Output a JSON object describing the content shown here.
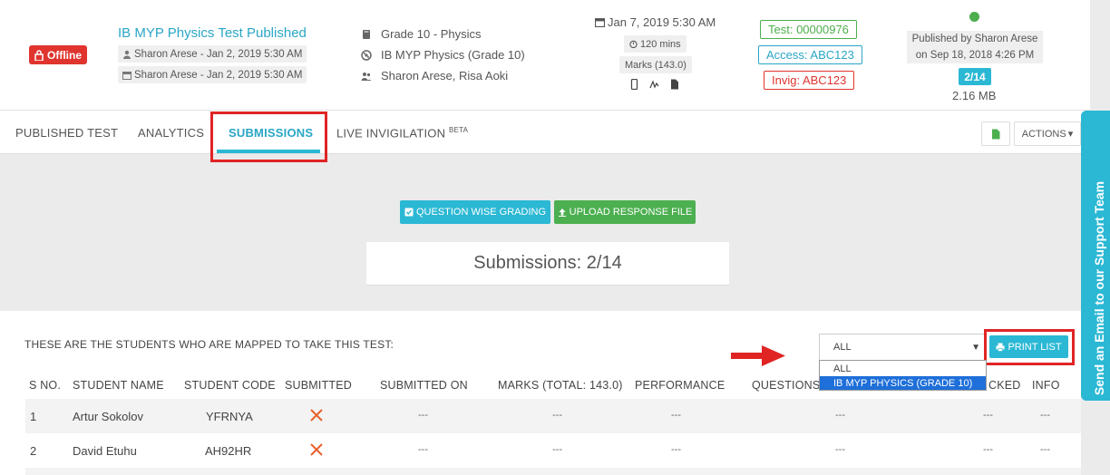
{
  "header": {
    "offline_label": "Offline",
    "test_title": "IB MYP Physics Test Published",
    "created_by": "Sharon Arese - Jan 2, 2019 5:30 AM",
    "modified_by": "Sharon Arese - Jan 2, 2019 5:30 AM",
    "grade": "Grade 10 - Physics",
    "course": "IB MYP Physics (Grade 10)",
    "teachers": "Sharon Arese, Risa Aoki",
    "date": "Jan 7, 2019 5:30 AM",
    "duration": "120 mins",
    "marks": "Marks (143.0)",
    "test_code": "Test: 00000976",
    "access_code": "Access: ABC123",
    "invig_code": "Invig: ABC123",
    "published_line1": "Published by Sharon Arese",
    "published_line2": "on Sep 18, 2018 4:26 PM",
    "submission_count": "2/14",
    "file_size": "2.16 MB"
  },
  "tabs": {
    "published": "PUBLISHED TEST",
    "analytics": "ANALYTICS",
    "submissions": "SUBMISSIONS",
    "live": "LIVE INVIGILATION",
    "live_badge": "BETA",
    "actions": "ACTIONS"
  },
  "support_tab": "Send an Email to our Support Team",
  "buttons": {
    "question_wise": "QUESTION WISE GRADING",
    "upload": "UPLOAD RESPONSE FILE",
    "print": "PRINT LIST"
  },
  "submissions_summary": "Submissions: 2/14",
  "students_panel": {
    "heading": "THESE ARE THE STUDENTS WHO ARE MAPPED TO TAKE THIS TEST:",
    "filter_selected": "ALL",
    "filter_options": [
      "ALL",
      "IB MYP PHYSICS (GRADE 10)"
    ],
    "columns": {
      "sno": "S NO.",
      "name": "STUDENT NAME",
      "code": "STUDENT CODE",
      "submitted": "SUBMITTED",
      "submitted_on": "SUBMITTED ON",
      "marks": "MARKS (TOTAL: 143.0)",
      "performance": "PERFORMANCE",
      "questions": "QUESTIONS",
      "checked": "CKED",
      "info": "INFO"
    },
    "rows": [
      {
        "sno": "1",
        "name": "Artur Sokolov",
        "code": "YFRNYA",
        "submitted_on": "---",
        "marks": "---",
        "performance": "---",
        "questions": "---",
        "checked": "---",
        "info": "---"
      },
      {
        "sno": "2",
        "name": "David Etuhu",
        "code": "AH92HR",
        "submitted_on": "---",
        "marks": "---",
        "performance": "---",
        "questions": "---",
        "checked": "---",
        "info": "---"
      }
    ]
  },
  "colors": {
    "accent": "#2bb8d4",
    "success": "#4caf50",
    "danger": "#e0342e",
    "highlight": "#e02424",
    "select_highlight": "#1e6fd9"
  },
  "icons": {
    "offline": "lock-icon",
    "author": "user-icon",
    "calendar": "calendar-icon",
    "grade": "book-icon",
    "course": "atom-icon",
    "teachers": "users-icon",
    "timer": "stopwatch-icon",
    "devices": [
      "mobile-icon",
      "signature-icon",
      "document-icon"
    ],
    "not_submitted": "cross-icon",
    "print": "printer-icon",
    "upload": "upload-icon",
    "grading": "check-square-icon"
  }
}
